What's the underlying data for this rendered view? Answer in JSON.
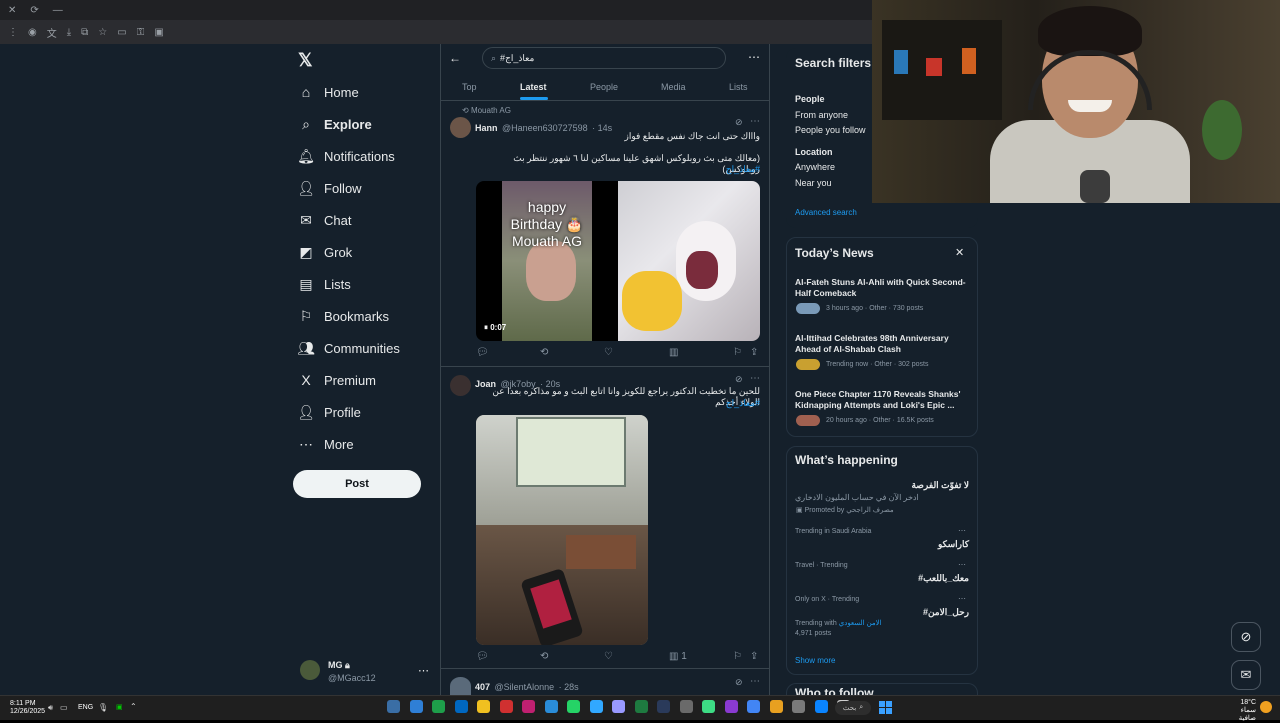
{
  "browser": {
    "title_controls": [
      "✕",
      "⟳",
      "—"
    ]
  },
  "nav": {
    "items": [
      {
        "label": "Home",
        "icon": "home-icon",
        "glyph": "⌂"
      },
      {
        "label": "Explore",
        "icon": "search-icon",
        "glyph": "⌕"
      },
      {
        "label": "Notifications",
        "icon": "bell-icon",
        "glyph": "🔔︎"
      },
      {
        "label": "Follow",
        "icon": "follow-icon",
        "glyph": "👤︎"
      },
      {
        "label": "Chat",
        "icon": "mail-icon",
        "glyph": "✉"
      },
      {
        "label": "Grok",
        "icon": "grok-icon",
        "glyph": "◩"
      },
      {
        "label": "Lists",
        "icon": "lists-icon",
        "glyph": "▤"
      },
      {
        "label": "Bookmarks",
        "icon": "bookmark-icon",
        "glyph": "⚐"
      },
      {
        "label": "Communities",
        "icon": "communities-icon",
        "glyph": "👥︎"
      },
      {
        "label": "Premium",
        "icon": "x-logo-icon",
        "glyph": "X"
      },
      {
        "label": "Profile",
        "icon": "profile-icon",
        "glyph": "👤︎"
      },
      {
        "label": "More",
        "icon": "more-icon",
        "glyph": "⋯"
      }
    ],
    "post_label": "Post",
    "account": {
      "name": "MG",
      "handle": "@MGacc12"
    }
  },
  "search": {
    "value": "#معاذ_اج",
    "tabs": [
      "Top",
      "Latest",
      "People",
      "Media",
      "Lists"
    ],
    "active_tab": "Latest"
  },
  "tweets": [
    {
      "reposted_by": "Mouath AG",
      "name": "Hann",
      "handle": "@Haneen630727598",
      "time": "14s",
      "text1": "واااك حتى انت جاك نفس مقطع فواز",
      "text2": "(معالك متى بث روبلوكس اشهق علينا مساكين لنا ٦ شهور ننتظر بث روبلوكس)",
      "hashtag": "#معاذ_اج",
      "media_caption": "happy Birthday 🎂 Mouath AG",
      "video_time": "0:07"
    },
    {
      "name": "Joan",
      "handle": "@jk7oby",
      "time": "20s",
      "text1": "للحين ما تخطيت الدكتور يراجع للكويز وانا اتابع البث و مو مذاكره بعدا عن الولاء أحذكم",
      "hashtag": "#معاذ_اج",
      "views": "1"
    },
    {
      "name": "407",
      "handle": "@SilentAlonne",
      "time": "28s"
    }
  ],
  "filters": {
    "title": "Search filters",
    "people_label": "People",
    "people_options": [
      "From anyone",
      "People you follow"
    ],
    "location_label": "Location",
    "location_options": [
      "Anywhere",
      "Near you"
    ],
    "advanced": "Advanced search"
  },
  "news": {
    "title": "Today’s News",
    "items": [
      {
        "headline": "Al-Fateh Stuns Al-Ahli with Quick Second-Half Comeback",
        "meta": "3 hours ago · Other · 730 posts"
      },
      {
        "headline": "Al-Ittihad Celebrates 98th Anniversary Ahead of Al-Shabab Clash",
        "meta": "Trending now · Other · 302 posts"
      },
      {
        "headline": "One Piece Chapter 1170 Reveals Shanks' Kidnapping Attempts and Loki's Epic ...",
        "meta": "20 hours ago · Other · 16.5K posts"
      }
    ]
  },
  "happening": {
    "title": "What’s happening",
    "promo_title": "لا تفوّت الفرصة",
    "promo_text": "ادخر الآن في حساب المليون الادخاري",
    "promo_by": "Promoted by",
    "promo_brand": "مصرف الراجحي",
    "trends": [
      {
        "context": "Trending in Saudi Arabia",
        "label": "كاراسكو"
      },
      {
        "context": "Travel · Trending",
        "label": "#معك_باللعب"
      },
      {
        "context": "Only on X · Trending",
        "label": "#رحل_الامن"
      }
    ],
    "trending_with": "Trending with",
    "trending_with_tag": "الامن السعودي",
    "posts": "4,971 posts",
    "show_more": "Show more",
    "next_heading": "Who to follow"
  },
  "taskbar": {
    "time": "8:11 PM",
    "date": "12/26/2025",
    "lang": "ENG",
    "weather": "18°C",
    "weather_text": "سماء صافية",
    "search_text": "بحث"
  },
  "colors": {
    "bg": "#15202b",
    "accent": "#1d9bf0",
    "border": "#38444d",
    "muted": "#8b98a5"
  }
}
